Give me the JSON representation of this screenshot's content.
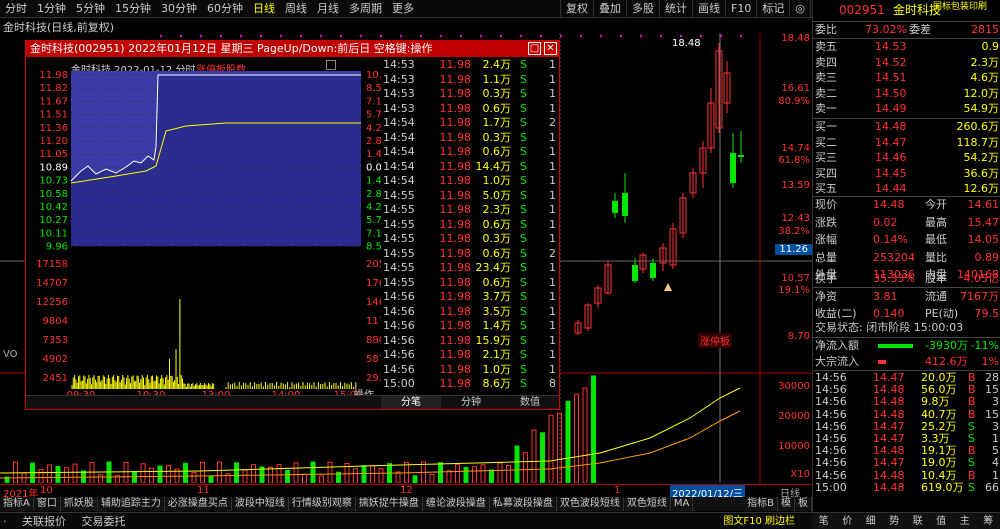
{
  "toolbar": {
    "periods": [
      "分时",
      "1分钟",
      "5分钟",
      "15分钟",
      "30分钟",
      "60分钟",
      "日线",
      "周线",
      "月线",
      "多周期",
      "更多"
    ],
    "active_period": "日线",
    "tools": [
      "复权",
      "叠加",
      "多股",
      "统计",
      "画线",
      "F10",
      "标记",
      "◎",
      "返回"
    ]
  },
  "chart": {
    "title": "金时科技(日线,前复权)",
    "price_labels": [
      "18.48",
      "16.61",
      "14.74",
      "13.59",
      "12.43",
      "10.57",
      "8.70"
    ],
    "pct_labels": [
      "80.9%",
      "61.8%",
      "38.2%",
      "19.1%"
    ],
    "current_marker": "11.26",
    "high_label": "18.48",
    "limit_up_label": "涨停板",
    "vol_labels": [
      "30000",
      "20000",
      "10000"
    ],
    "vol_unit": "X10",
    "vol_title": "VO",
    "date_labels": [
      "2021年",
      "10",
      "11",
      "12",
      "1"
    ],
    "cursor_date": "2022/01/12/三",
    "mode_label": "日线"
  },
  "popup": {
    "title": "金时科技(002951) 2022年01月12日 星期三 PageUp/Down:前后日 空格键:操作",
    "inner_title": "金时科技  2022-01-12  分时",
    "inner_badge": "涨停板股数",
    "price_axis": [
      "11.98",
      "11.82",
      "11.67",
      "11.51",
      "11.36",
      "11.20",
      "11.05",
      "10.89",
      "10.73",
      "10.58",
      "10.42",
      "10.27",
      "10.11",
      "9.96"
    ],
    "pct_axis": [
      "10.01%",
      "8.58%",
      "7.15%",
      "5.72%",
      "4.29%",
      "2.86%",
      "1.43%",
      "0.00%",
      "1.43%",
      "2.86%",
      "4.29%",
      "5.72%",
      "7.15%",
      "8.58%"
    ],
    "vol_axis": [
      "17158",
      "14707",
      "12256",
      "9804",
      "7353",
      "4902",
      "2451"
    ],
    "vol_right": [
      "2056万",
      "1762万",
      "1468万",
      "1175万",
      "880.9万",
      "587.3万",
      "293.6万"
    ],
    "time_axis": [
      "09:30",
      "10:30",
      "13:00",
      "14:00",
      "15:00"
    ],
    "action_label": "操作",
    "ticks": [
      {
        "t": "14:53",
        "p": "11.98",
        "v": "2.4万",
        "f": "S",
        "c": "1"
      },
      {
        "t": "14:53",
        "p": "11.98",
        "v": "1.1万",
        "f": "S",
        "c": "1"
      },
      {
        "t": "14:53",
        "p": "11.98",
        "v": "0.3万",
        "f": "S",
        "c": "1"
      },
      {
        "t": "14:53",
        "p": "11.98",
        "v": "0.6万",
        "f": "S",
        "c": "1"
      },
      {
        "t": "14:54",
        "p": "11.98",
        "v": "1.7万",
        "f": "S",
        "c": "2"
      },
      {
        "t": "14:54",
        "p": "11.98",
        "v": "0.3万",
        "f": "S",
        "c": "1"
      },
      {
        "t": "14:54",
        "p": "11.98",
        "v": "0.6万",
        "f": "S",
        "c": "1"
      },
      {
        "t": "14:54",
        "p": "11.98",
        "v": "14.4万",
        "f": "S",
        "c": "1"
      },
      {
        "t": "14:54",
        "p": "11.98",
        "v": "1.0万",
        "f": "S",
        "c": "1"
      },
      {
        "t": "14:55",
        "p": "11.98",
        "v": "5.0万",
        "f": "S",
        "c": "1"
      },
      {
        "t": "14:55",
        "p": "11.98",
        "v": "2.3万",
        "f": "S",
        "c": "1"
      },
      {
        "t": "14:55",
        "p": "11.98",
        "v": "0.6万",
        "f": "S",
        "c": "1"
      },
      {
        "t": "14:55",
        "p": "11.98",
        "v": "0.3万",
        "f": "S",
        "c": "1"
      },
      {
        "t": "14:55",
        "p": "11.98",
        "v": "0.6万",
        "f": "S",
        "c": "2"
      },
      {
        "t": "14:55",
        "p": "11.98",
        "v": "23.4万",
        "f": "S",
        "c": "1"
      },
      {
        "t": "14:55",
        "p": "11.98",
        "v": "0.6万",
        "f": "S",
        "c": "1"
      },
      {
        "t": "14:56",
        "p": "11.98",
        "v": "3.7万",
        "f": "S",
        "c": "1"
      },
      {
        "t": "14:56",
        "p": "11.98",
        "v": "3.5万",
        "f": "S",
        "c": "1"
      },
      {
        "t": "14:56",
        "p": "11.98",
        "v": "1.4万",
        "f": "S",
        "c": "1"
      },
      {
        "t": "14:56",
        "p": "11.98",
        "v": "15.9万",
        "f": "S",
        "c": "1"
      },
      {
        "t": "14:56",
        "p": "11.98",
        "v": "2.1万",
        "f": "S",
        "c": "1"
      },
      {
        "t": "14:56",
        "p": "11.98",
        "v": "1.0万",
        "f": "S",
        "c": "1"
      },
      {
        "t": "15:00",
        "p": "11.98",
        "v": "8.6万",
        "f": "S",
        "c": "8"
      }
    ],
    "tabs": [
      "分笔",
      "分钟",
      "数值"
    ]
  },
  "right_panel": {
    "code": "002951",
    "name": "金时科技",
    "top_right": "同标包装印刷",
    "weibi_label": "委比",
    "weibi": "73.02%",
    "weicha_label": "委差",
    "weicha": "2815",
    "asks": [
      {
        "label": "卖五",
        "price": "14.53",
        "vol": "0.9"
      },
      {
        "label": "卖四",
        "price": "14.52",
        "vol": "2.3万"
      },
      {
        "label": "卖三",
        "price": "14.51",
        "vol": "4.6万"
      },
      {
        "label": "卖二",
        "price": "14.50",
        "vol": "12.0万"
      },
      {
        "label": "卖一",
        "price": "14.49",
        "vol": "54.9万"
      }
    ],
    "bids": [
      {
        "label": "买一",
        "price": "14.48",
        "vol": "260.6万"
      },
      {
        "label": "买二",
        "price": "14.47",
        "vol": "118.7万"
      },
      {
        "label": "买三",
        "price": "14.46",
        "vol": "54.2万"
      },
      {
        "label": "买四",
        "price": "14.45",
        "vol": "36.6万"
      },
      {
        "label": "买五",
        "price": "14.44",
        "vol": "12.6万"
      }
    ],
    "stats": [
      {
        "l1": "现价",
        "v1": "14.48",
        "l2": "今开",
        "v2": "14.61"
      },
      {
        "l1": "涨跌",
        "v1": "0.02",
        "l2": "最高",
        "v2": "15.47"
      },
      {
        "l1": "涨幅",
        "v1": "0.14%",
        "l2": "最低",
        "v2": "14.05"
      },
      {
        "l1": "总量",
        "v1": "253204",
        "l2": "量比",
        "v2": "0.89"
      },
      {
        "l1": "外盘",
        "v1": "113036",
        "l2": "内盘",
        "v2": "140168"
      }
    ],
    "stats2": [
      {
        "l1": "换手",
        "v1": "35.33%",
        "l2": "股本",
        "v2": "4.05亿"
      },
      {
        "l1": "净资",
        "v1": "3.81",
        "l2": "流通",
        "v2": "7167万"
      },
      {
        "l1": "收益(二)",
        "v1": "0.140",
        "l2": "PE(动)",
        "v2": "79.5"
      }
    ],
    "trade_status": "交易状态: 闭市阶段 15:00:03",
    "netflow_label": "净流入额",
    "netflow_value": "-3930万",
    "netflow_pct": "-11%",
    "bigflow_label": "大宗流入",
    "bigflow_value": "412.6万",
    "bigflow_pct": "1%",
    "ticks": [
      {
        "t": "14:56",
        "p": "14.47",
        "v": "20.0万",
        "f": "B",
        "c": "28"
      },
      {
        "t": "14:56",
        "p": "14.48",
        "v": "56.0万",
        "f": "B",
        "c": "15"
      },
      {
        "t": "14:56",
        "p": "14.48",
        "v": "9.8万",
        "f": "B",
        "c": "3"
      },
      {
        "t": "14:56",
        "p": "14.48",
        "v": "40.7万",
        "f": "B",
        "c": "15"
      },
      {
        "t": "14:56",
        "p": "14.47",
        "v": "25.2万",
        "f": "S",
        "c": "3"
      },
      {
        "t": "14:56",
        "p": "14.47",
        "v": "3.3万",
        "f": "S",
        "c": "1"
      },
      {
        "t": "14:56",
        "p": "14.48",
        "v": "19.1万",
        "f": "B",
        "c": "5"
      },
      {
        "t": "14:56",
        "p": "14.47",
        "v": "19.0万",
        "f": "S",
        "c": "4"
      },
      {
        "t": "14:56",
        "p": "14.48",
        "v": "10.4万",
        "f": "B",
        "c": "1"
      },
      {
        "t": "15:00",
        "p": "14.48",
        "v": "619.0万",
        "f": "S",
        "c": "66"
      }
    ]
  },
  "bottom_tabs": [
    "指标A",
    "窗口",
    "抓妖股",
    "辅助追踪主力",
    "必涨操盘买点",
    "波段中短线",
    "行情级别观察",
    "擒妖捉牛操盘",
    "缠论波段操盘",
    "私募波段操盘",
    "双色波段短线",
    "双色短线",
    "MA"
  ],
  "bottom_tabs_right": [
    "指标B",
    "模",
    "板"
  ],
  "status": {
    "item1": "关联报价",
    "item2": "交易委托",
    "right": "图文F10 刷边栏"
  },
  "bottom_icons": [
    "笔",
    "价",
    "细",
    "势",
    "联",
    "值",
    "主",
    "筹"
  ]
}
